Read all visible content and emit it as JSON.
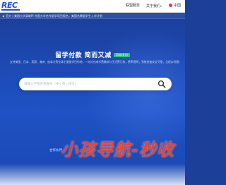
{
  "header": {
    "logo_text": "REC",
    "nav": [
      {
        "label": "联盟服务"
      },
      {
        "label": "关于我们",
        "caret": "▾"
      }
    ],
    "language": "中国"
  },
  "notice": {
    "icon": "speaker-icon",
    "text": "官方 | 美国大学录取PI 外国大学合作留学项目报名，美国名牌留学生入学计划"
  },
  "hero": {
    "title": "留学付款  简而又减",
    "badge": "Check in",
    "description": "支持美国、日本、英国、澳洲、加拿大等全球主要留学目的地，一站式完成学费缴纳与生活费汇款，费率透明，到账快速安全可靠，全程实时跟踪订单状态"
  },
  "search": {
    "placeholder": "请输入学校名称查找（中 / 英 / 拼写）",
    "button_icon": "search-icon"
  },
  "footer": {
    "support_label": "合作伙伴"
  },
  "watermark": {
    "text": "小孩导航-秒收"
  },
  "colors": {
    "brand": "#1a56d6",
    "background": "#1d49b2",
    "badge": "#2ec27e",
    "watermark": "#ec3c28"
  }
}
